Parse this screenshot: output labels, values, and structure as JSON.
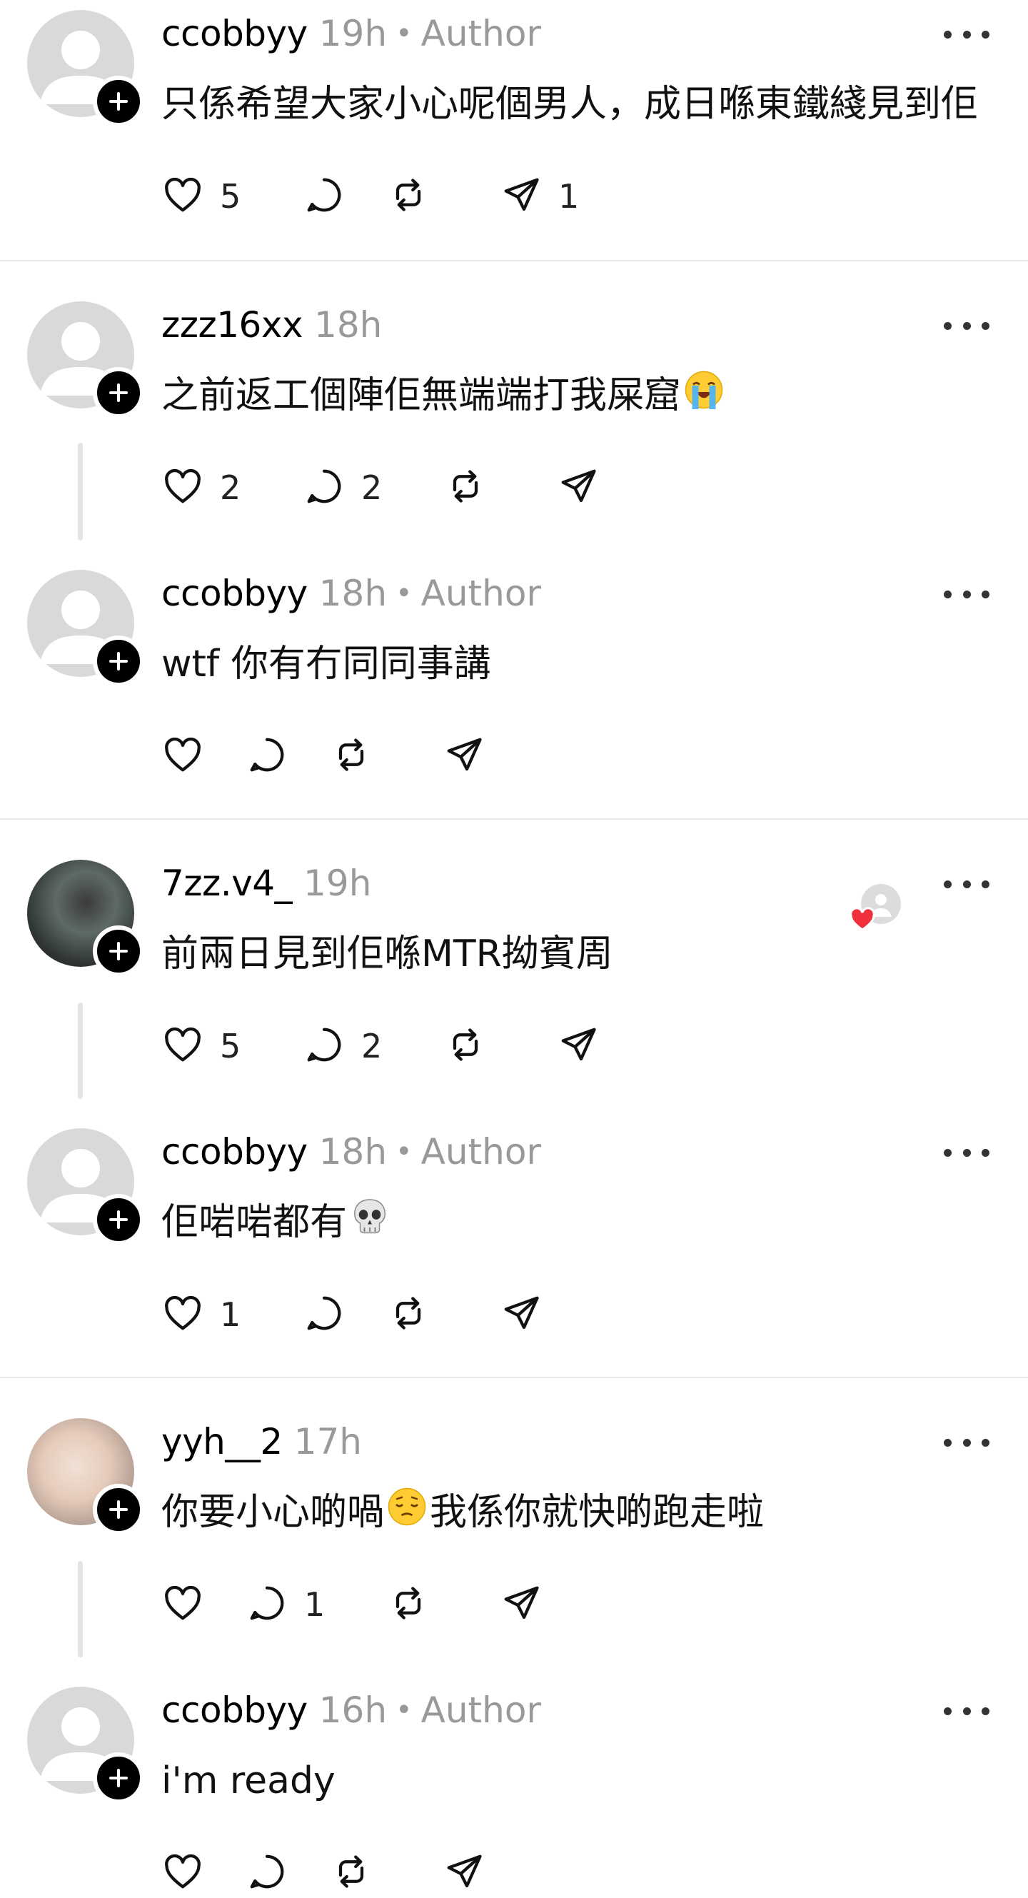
{
  "labels": {
    "author": "Author",
    "dot": "•"
  },
  "posts": [
    {
      "username": "ccobbyy",
      "time": "19h",
      "is_author": true,
      "avatar": "default",
      "text": "只係希望大家小心呢個男人，成日喺東鐵綫見到佢",
      "emoji": "",
      "likes": "5",
      "replies": "",
      "shares": "1"
    },
    {
      "username": "zzz16xx",
      "time": "18h",
      "is_author": false,
      "avatar": "default",
      "text": "之前返工個陣佢無端端打我屎窟",
      "emoji": "loudly-crying-face",
      "likes": "2",
      "replies": "2",
      "shares": ""
    },
    {
      "username": "ccobbyy",
      "time": "18h",
      "is_author": true,
      "avatar": "default",
      "text": "wtf 你有冇同同事講",
      "emoji": "",
      "likes": "",
      "replies": "",
      "shares": ""
    },
    {
      "username": "7zz.v4_",
      "time": "19h",
      "is_author": false,
      "avatar": "photo-1",
      "text": "前兩日見到佢喺MTR拗賓周",
      "emoji": "",
      "likes": "5",
      "replies": "2",
      "shares": "",
      "liked_by_author": true
    },
    {
      "username": "ccobbyy",
      "time": "18h",
      "is_author": true,
      "avatar": "default",
      "text": "佢啱啱都有",
      "emoji": "skull",
      "likes": "1",
      "replies": "",
      "shares": ""
    },
    {
      "username": "yyh__2",
      "time": "17h",
      "is_author": false,
      "avatar": "photo-2",
      "text": "你要小心啲喎",
      "emoji": "pensive-face",
      "text_after": "我係你就快啲跑走啦",
      "likes": "",
      "replies": "1",
      "shares": ""
    },
    {
      "username": "ccobbyy",
      "time": "16h",
      "is_author": true,
      "avatar": "default",
      "text": "i'm ready",
      "emoji": "",
      "likes": "",
      "replies": "",
      "shares": ""
    }
  ],
  "icons": {
    "like": "heart-icon",
    "reply": "comment-icon",
    "repost": "repost-icon",
    "share": "send-icon",
    "more": "more-icon",
    "follow": "plus-icon"
  },
  "colors": {
    "muted": "#999999",
    "divider": "#e7e7e7",
    "heart_red": "#f0303c"
  }
}
